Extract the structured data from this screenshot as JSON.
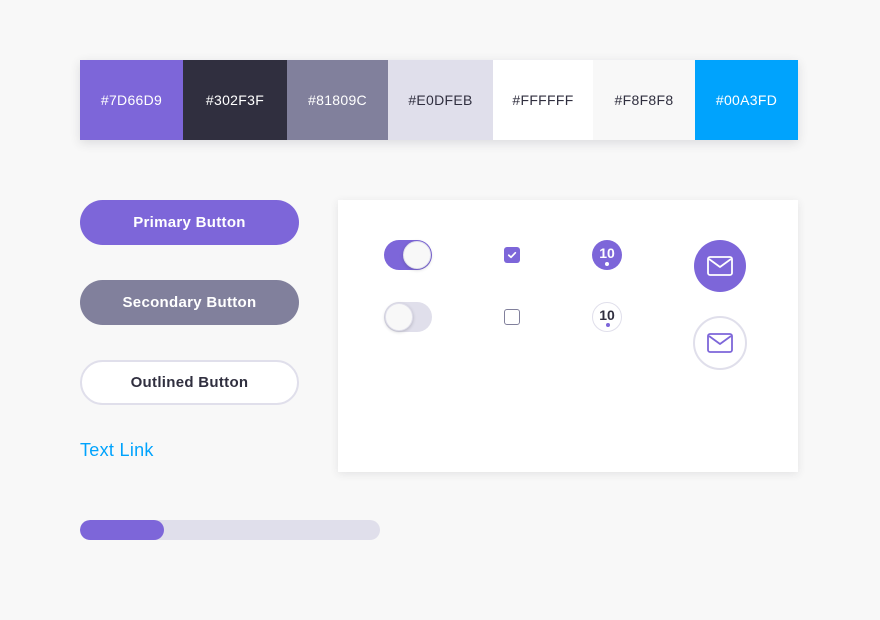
{
  "palette": {
    "swatches": [
      {
        "hex": "#7D66D9",
        "text_color": "#FFFFFF"
      },
      {
        "hex": "#302F3F",
        "text_color": "#FFFFFF"
      },
      {
        "hex": "#81809C",
        "text_color": "#FFFFFF"
      },
      {
        "hex": "#E0DFEB",
        "text_color": "#302F3F"
      },
      {
        "hex": "#FFFFFF",
        "text_color": "#302F3F"
      },
      {
        "hex": "#F8F8F8",
        "text_color": "#302F3F"
      },
      {
        "hex": "#00A3FD",
        "text_color": "#FFFFFF"
      }
    ]
  },
  "buttons": {
    "primary_label": "Primary Button",
    "secondary_label": "Secondary Button",
    "outlined_label": "Outlined Button"
  },
  "text_link": "Text Link",
  "progress": {
    "value": 0.28
  },
  "controls": {
    "toggle_on": true,
    "toggle_off": false,
    "checkbox_checked": true,
    "checkbox_unchecked": false,
    "badge_filled_count": "10",
    "badge_outline_count": "10",
    "mail_icon": "mail-icon"
  },
  "colors": {
    "accent": "#7D66D9",
    "dark": "#302F3F",
    "muted": "#81809C",
    "light": "#E0DFEB",
    "link": "#00A3FD"
  }
}
